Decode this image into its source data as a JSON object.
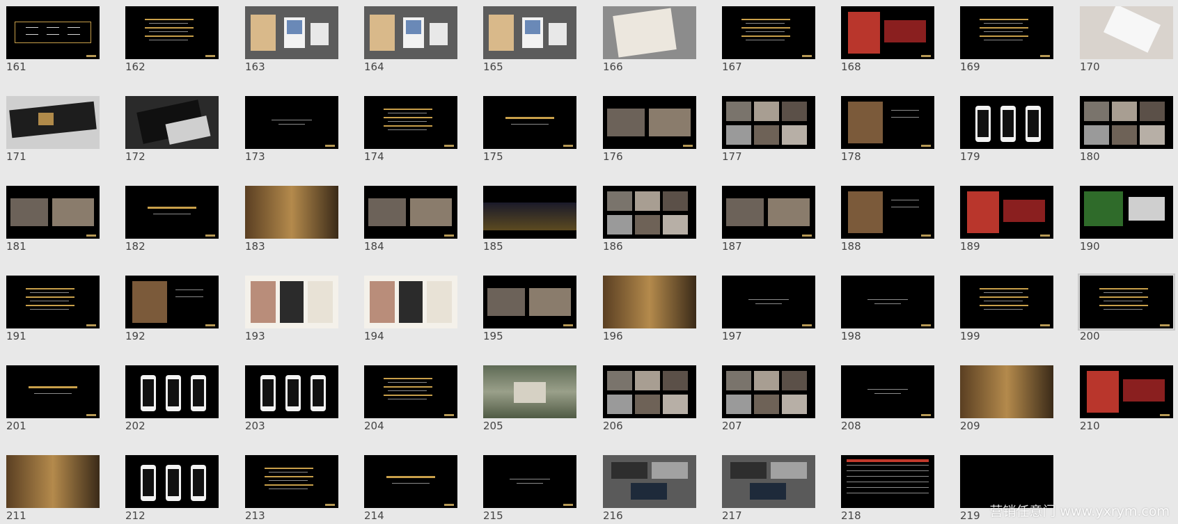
{
  "panel": {
    "name": "slide-sorter"
  },
  "selected_slide": "200",
  "watermark": {
    "text": "营销任意门 www.yxrym.com"
  },
  "colors": {
    "thumb_bg": "#000000",
    "gold_text": "#c9a04a",
    "white_text": "#d8d8d8",
    "panel_bg": "#e8e8e8",
    "gray_slide": "#5a5a5a",
    "light_slide": "#d9d3cd"
  },
  "slides": [
    {
      "n": "161",
      "style": "dark-diagram"
    },
    {
      "n": "162",
      "style": "dark-text-gold"
    },
    {
      "n": "163",
      "style": "gray-books"
    },
    {
      "n": "164",
      "style": "gray-books"
    },
    {
      "n": "165",
      "style": "gray-books"
    },
    {
      "n": "166",
      "style": "light-box"
    },
    {
      "n": "167",
      "style": "dark-text-gold"
    },
    {
      "n": "168",
      "style": "dark-red-photo"
    },
    {
      "n": "169",
      "style": "dark-text-gold"
    },
    {
      "n": "170",
      "style": "light-object"
    },
    {
      "n": "171",
      "style": "light-scroll"
    },
    {
      "n": "172",
      "style": "gray-book"
    },
    {
      "n": "173",
      "style": "dark-title"
    },
    {
      "n": "174",
      "style": "dark-text-gold"
    },
    {
      "n": "175",
      "style": "dark-title-gold"
    },
    {
      "n": "176",
      "style": "dark-photos"
    },
    {
      "n": "177",
      "style": "dark-photo-grid"
    },
    {
      "n": "178",
      "style": "dark-person"
    },
    {
      "n": "179",
      "style": "dark-phones"
    },
    {
      "n": "180",
      "style": "dark-photo-grid"
    },
    {
      "n": "181",
      "style": "dark-photos"
    },
    {
      "n": "182",
      "style": "dark-title-gold"
    },
    {
      "n": "183",
      "style": "warm-photo"
    },
    {
      "n": "184",
      "style": "dark-photos"
    },
    {
      "n": "185",
      "style": "dark-night"
    },
    {
      "n": "186",
      "style": "dark-photo-grid"
    },
    {
      "n": "187",
      "style": "dark-photos"
    },
    {
      "n": "188",
      "style": "dark-person"
    },
    {
      "n": "189",
      "style": "dark-red-photo"
    },
    {
      "n": "190",
      "style": "dark-green-photo"
    },
    {
      "n": "191",
      "style": "dark-text-gold"
    },
    {
      "n": "192",
      "style": "dark-person"
    },
    {
      "n": "193",
      "style": "white-poster"
    },
    {
      "n": "194",
      "style": "white-poster"
    },
    {
      "n": "195",
      "style": "dark-photos"
    },
    {
      "n": "196",
      "style": "warm-photo"
    },
    {
      "n": "197",
      "style": "dark-title"
    },
    {
      "n": "198",
      "style": "dark-title"
    },
    {
      "n": "199",
      "style": "dark-text-gold"
    },
    {
      "n": "200",
      "style": "dark-text-gold"
    },
    {
      "n": "201",
      "style": "dark-title-gold"
    },
    {
      "n": "202",
      "style": "dark-phones"
    },
    {
      "n": "203",
      "style": "dark-phones"
    },
    {
      "n": "204",
      "style": "dark-text-gold"
    },
    {
      "n": "205",
      "style": "aerial-photo"
    },
    {
      "n": "206",
      "style": "dark-photo-grid"
    },
    {
      "n": "207",
      "style": "dark-photo-grid"
    },
    {
      "n": "208",
      "style": "dark-title"
    },
    {
      "n": "209",
      "style": "warm-photo"
    },
    {
      "n": "210",
      "style": "dark-red-photo"
    },
    {
      "n": "211",
      "style": "warm-photo"
    },
    {
      "n": "212",
      "style": "dark-phones"
    },
    {
      "n": "213",
      "style": "dark-text-gold"
    },
    {
      "n": "214",
      "style": "dark-title-gold"
    },
    {
      "n": "215",
      "style": "dark-title"
    },
    {
      "n": "216",
      "style": "gray-slide"
    },
    {
      "n": "217",
      "style": "gray-slide"
    },
    {
      "n": "218",
      "style": "dark-table"
    },
    {
      "n": "219",
      "style": "dark-empty"
    }
  ]
}
